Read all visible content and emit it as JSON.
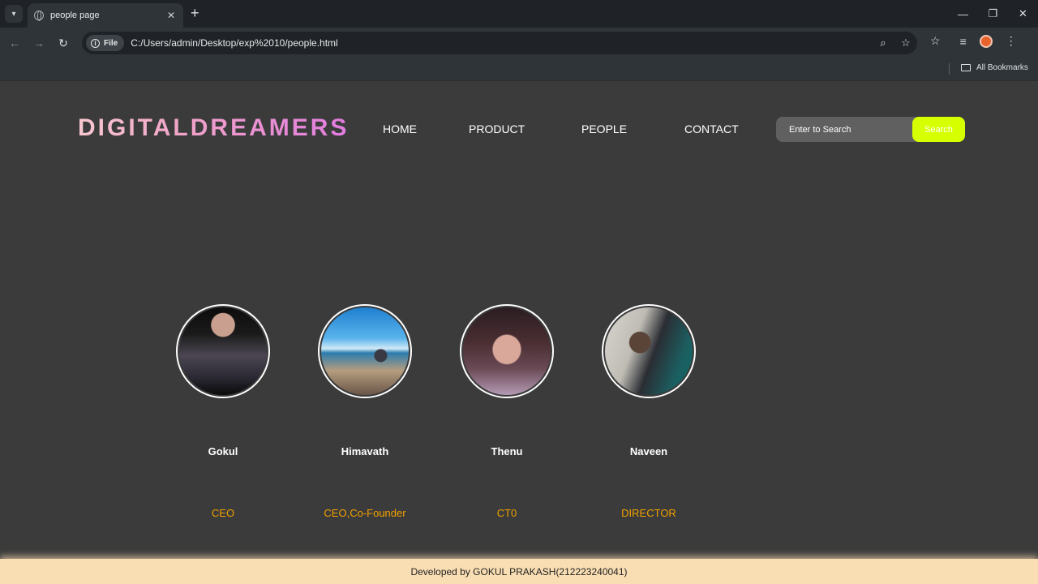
{
  "browser": {
    "tab_title": "people page",
    "chip_label": "File",
    "url": "C:/Users/admin/Desktop/exp%2010/people.html",
    "bookmarks_label": "All Bookmarks"
  },
  "site": {
    "logo": "DIGITALDREAMERS",
    "nav": [
      {
        "label": "HOME"
      },
      {
        "label": "PRODUCT"
      },
      {
        "label": "PEOPLE"
      },
      {
        "label": "CONTACT"
      }
    ],
    "search": {
      "placeholder": "Enter to Search",
      "button_label": "Search"
    },
    "accent_color": "#d6ff00",
    "role_color": "#f2a100"
  },
  "people": [
    {
      "name": "Gokul",
      "role": "CEO"
    },
    {
      "name": "Himavath",
      "role": "CEO,Co-Founder"
    },
    {
      "name": "Thenu",
      "role": "CT0"
    },
    {
      "name": "Naveen",
      "role": "DIRECTOR"
    }
  ],
  "footer": {
    "text": "Developed by GOKUL PRAKASH(212223240041)"
  }
}
